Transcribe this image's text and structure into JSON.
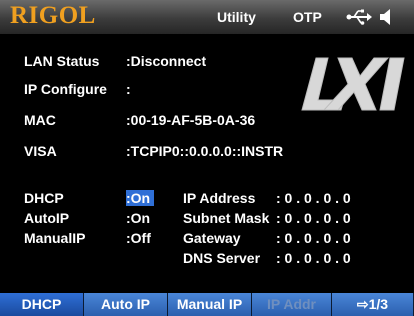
{
  "header": {
    "brand": "RIGOL",
    "mode": "Utility",
    "status": "OTP",
    "usb_icon": "usb-icon",
    "speaker_icon": "speaker-icon"
  },
  "info": [
    {
      "label": "LAN Status",
      "value": ":Disconnect"
    },
    {
      "label": "IP Configure",
      "value": ":"
    },
    {
      "label": "MAC",
      "value": ":00-19-AF-5B-0A-36"
    },
    {
      "label": "VISA",
      "value": ":TCPIP0::0.0.0.0::INSTR"
    }
  ],
  "modes": [
    {
      "label": "DHCP",
      "value": ":On",
      "selected": true
    },
    {
      "label": "AutoIP",
      "value": ":On"
    },
    {
      "label": "ManualIP",
      "value": ":Off"
    }
  ],
  "network": [
    {
      "label": "IP Address",
      "value": ": 0 . 0 . 0 . 0"
    },
    {
      "label": "Subnet Mask",
      "value": ": 0 . 0 . 0 . 0"
    },
    {
      "label": "Gateway",
      "value": ": 0 . 0 . 0 . 0"
    },
    {
      "label": "DNS Server",
      "value": ": 0 . 0 . 0 . 0"
    }
  ],
  "logo": "LXI",
  "softkeys": {
    "dhcp": "DHCP",
    "autoip": "Auto IP",
    "manualip": "Manual IP",
    "ipaddr": "IP Addr",
    "page": "⇨1/3"
  },
  "colors": {
    "brand": "#f0a020",
    "accent": "#2f6fd6",
    "softkey": "#3a74c6"
  }
}
